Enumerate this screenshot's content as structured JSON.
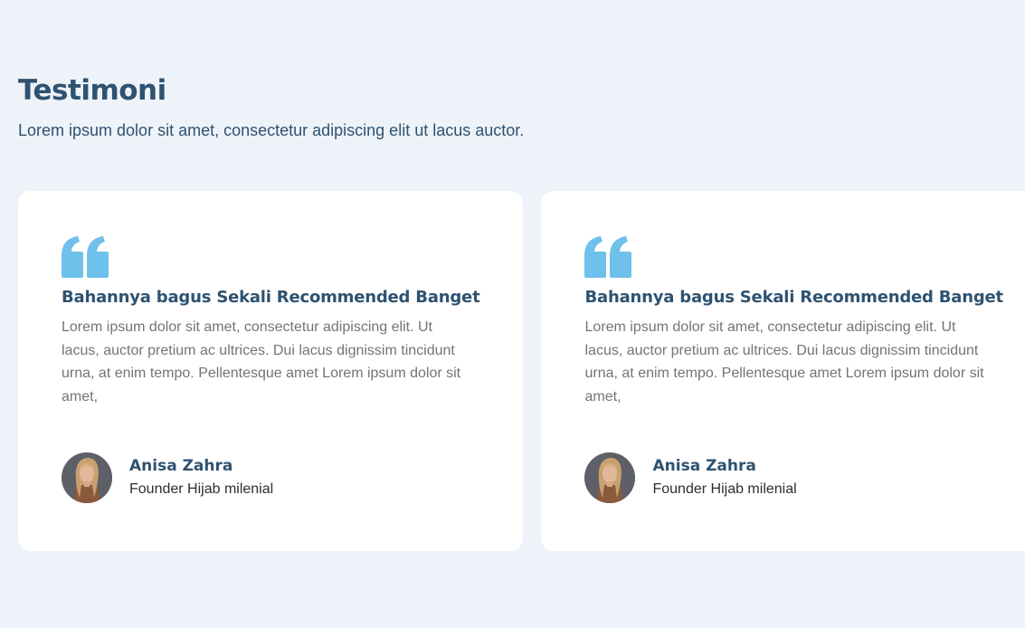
{
  "header": {
    "title": "Testimoni",
    "subtitle": "Lorem ipsum dolor sit amet, consectetur adipiscing elit ut lacus auctor."
  },
  "colors": {
    "background": "#eef3f9",
    "heading": "#2f5270",
    "quote_icon": "#6ec1ea",
    "body_text": "#707579",
    "card": "#ffffff"
  },
  "testimonials": [
    {
      "icon": "quote-icon",
      "title": "Bahannya bagus Sekali Recommended Banget",
      "body": "Lorem ipsum dolor sit amet, consectetur adipiscing elit. Ut lacus, auctor pretium ac ultrices. Dui lacus dignissim tincidunt urna, at enim tempo. Pellentesque amet Lorem ipsum dolor sit amet,",
      "author_name": "Anisa Zahra",
      "author_role": "Founder Hijab milenial"
    },
    {
      "icon": "quote-icon",
      "title": "Bahannya bagus Sekali Recommended Banget",
      "body": "Lorem ipsum dolor sit amet, consectetur adipiscing elit. Ut lacus, auctor pretium ac ultrices. Dui lacus dignissim tincidunt urna, at enim tempo. Pellentesque amet Lorem ipsum dolor sit amet,",
      "author_name": "Anisa Zahra",
      "author_role": "Founder Hijab milenial"
    }
  ]
}
